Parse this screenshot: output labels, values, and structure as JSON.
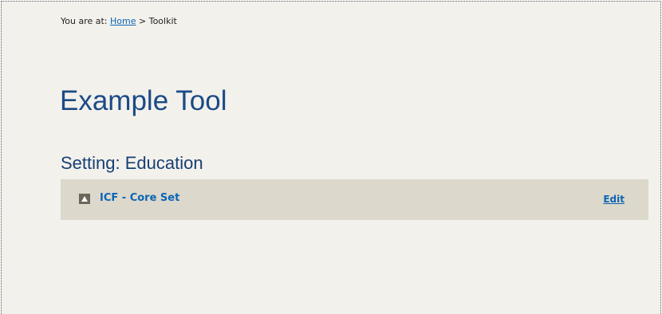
{
  "breadcrumb": {
    "prefix": "You are at:",
    "home_label": "Home",
    "separator": ">",
    "current": "Toolkit"
  },
  "page": {
    "title": "Example Tool",
    "setting_heading": "Setting: Education"
  },
  "tool_item": {
    "toggle_icon": "expand-triangle-up-icon",
    "name": "ICF - Core Set",
    "edit_label": "Edit"
  },
  "colors": {
    "background": "#f3f1ec",
    "row_background": "#dcd8cb",
    "link": "#0b65b5",
    "title": "#1b4a86"
  }
}
